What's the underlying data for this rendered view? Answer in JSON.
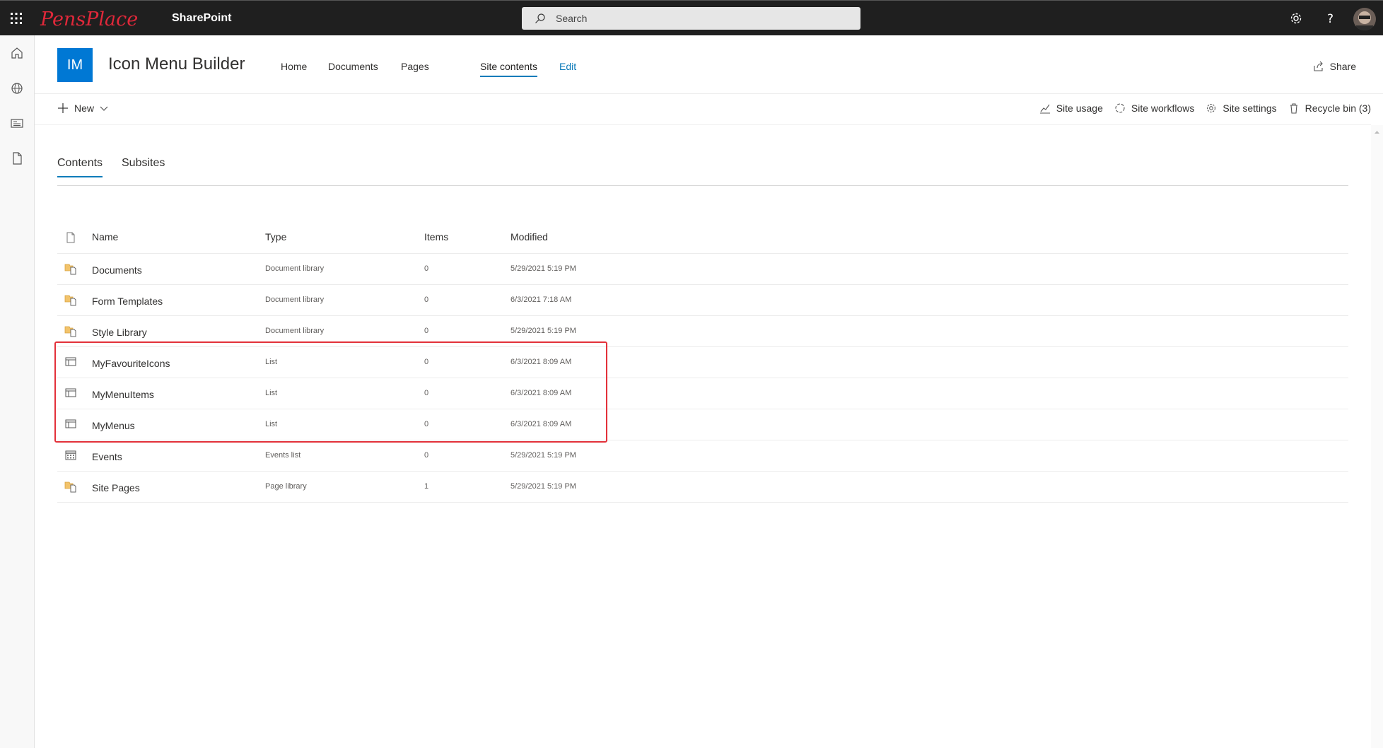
{
  "suitebar": {
    "logo_text": "PensPlace",
    "app_name": "SharePoint",
    "search_placeholder": "Search"
  },
  "site": {
    "logo_initials": "IM",
    "title": "Icon Menu Builder",
    "nav": [
      "Home",
      "Documents",
      "Pages",
      "Site contents",
      "Edit"
    ],
    "share_label": "Share"
  },
  "command_bar": {
    "new_label": "New",
    "site_usage": "Site usage",
    "site_workflows": "Site workflows",
    "site_settings": "Site settings",
    "recycle_bin": "Recycle bin (3)"
  },
  "pivot": {
    "contents": "Contents",
    "subsites": "Subsites"
  },
  "table": {
    "headers": {
      "name": "Name",
      "type": "Type",
      "items": "Items",
      "modified": "Modified"
    },
    "rows": [
      {
        "name": "Documents",
        "type": "Document library",
        "items": "0",
        "modified": "5/29/2021 5:19 PM",
        "icon": "document-library-icon"
      },
      {
        "name": "Form Templates",
        "type": "Document library",
        "items": "0",
        "modified": "6/3/2021 7:18 AM",
        "icon": "document-library-icon"
      },
      {
        "name": "Style Library",
        "type": "Document library",
        "items": "0",
        "modified": "5/29/2021 5:19 PM",
        "icon": "document-library-icon"
      },
      {
        "name": "MyFavouriteIcons",
        "type": "List",
        "items": "0",
        "modified": "6/3/2021 8:09 AM",
        "icon": "list-icon"
      },
      {
        "name": "MyMenuItems",
        "type": "List",
        "items": "0",
        "modified": "6/3/2021 8:09 AM",
        "icon": "list-icon"
      },
      {
        "name": "MyMenus",
        "type": "List",
        "items": "0",
        "modified": "6/3/2021 8:09 AM",
        "icon": "list-icon"
      },
      {
        "name": "Events",
        "type": "Events list",
        "items": "0",
        "modified": "5/29/2021 5:19 PM",
        "icon": "calendar-icon"
      },
      {
        "name": "Site Pages",
        "type": "Page library",
        "items": "1",
        "modified": "5/29/2021 5:19 PM",
        "icon": "page-library-icon"
      }
    ]
  },
  "colors": {
    "accent": "#0f7cba",
    "site_logo": "#0078d4",
    "highlight": "#e3313a",
    "suitebar": "#1f1f1f"
  }
}
